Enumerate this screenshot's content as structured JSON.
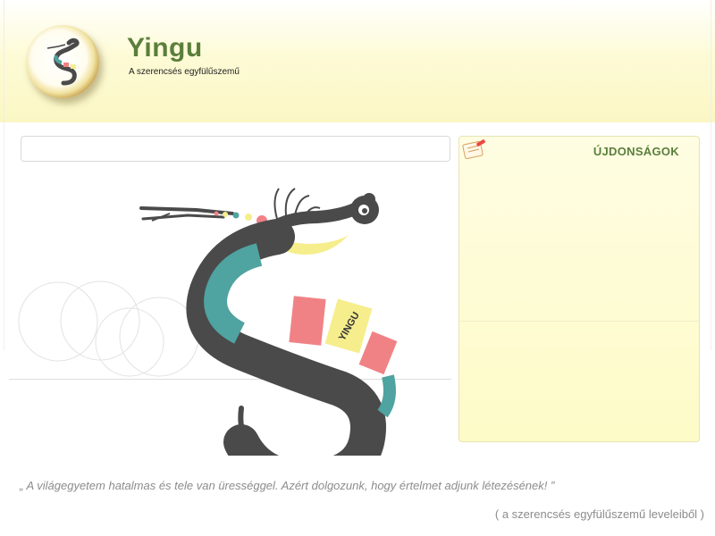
{
  "header": {
    "title": "Yingu",
    "subtitle": "A szerencsés egyfülűszemű"
  },
  "sidebar": {
    "news_title": "ÚJDONSÁGOK"
  },
  "illustration": {
    "snake_label": "YINGU"
  },
  "footer": {
    "quote": "„ A világegyetem hatalmas és tele van ürességgel. Azért dolgozunk, hogy értelmet adjunk létezésének! ”",
    "quote_source": "( a szerencsés egyfülűszemű leveleiből )"
  },
  "colors": {
    "accent_green": "#5b7e3c",
    "header_yellow": "#fbf7c4",
    "snake_dark": "#4a4a4a",
    "snake_teal": "#4fa3a0",
    "snake_pink": "#f08286",
    "snake_yellow": "#f6ee8c"
  }
}
